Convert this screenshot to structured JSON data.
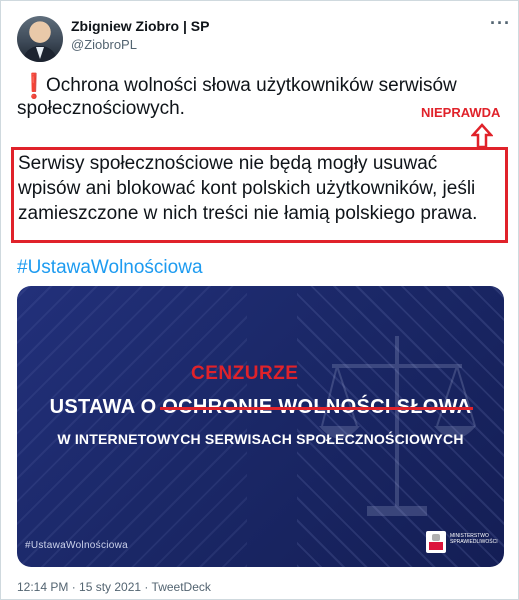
{
  "author": {
    "name": "Zbigniew Ziobro | SP",
    "handle": "@ZiobroPL"
  },
  "menu_icon": "more-horizontal-icon",
  "tweet": {
    "exclamation": "❗",
    "line1": "Ochrona wolności słowa użytkowników serwisów",
    "line2": "społecznościowych.",
    "boxed_text": "Serwisy społecznościowe nie będą mogły usuwać wpisów ani blokować kont polskich użytkowników, jeśli zamieszczone w nich treści nie łamią polskiego prawa.",
    "hashtag": "#UstawaWolnościowa"
  },
  "annotation": {
    "label": "NIEPRAWDA",
    "color": "#e0222a"
  },
  "card": {
    "overlay_word": "CENZURZE",
    "headline_prefix": "USTAWA O",
    "headline_struck": "OCHRONIE WOLNOŚCI SŁOWA",
    "subline": "W INTERNETOWYCH SERWISACH SPOŁECZNOŚCIOWYCH",
    "hashtag": "#UstawaWolnościowa",
    "ministry_text": "MINISTERSTWO SPRAWIEDLIWOŚCI"
  },
  "meta": "12:14 PM · 15 sty 2021 · TweetDeck",
  "colors": {
    "accent_red": "#e0222a",
    "link_blue": "#1d9bf0",
    "card_navy": "#1b2868"
  }
}
